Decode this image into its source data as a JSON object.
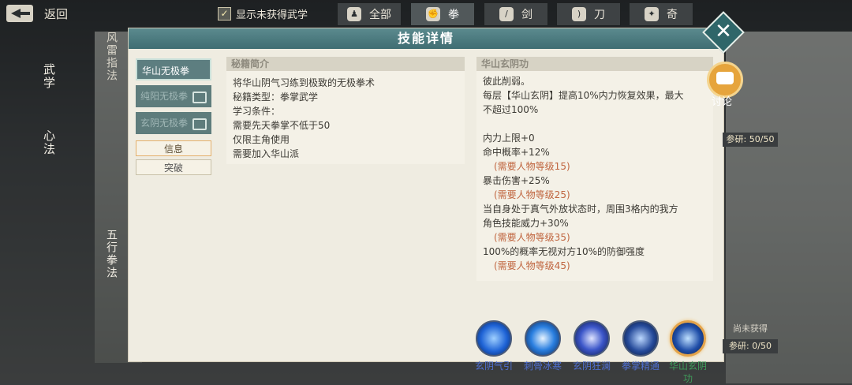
{
  "topbar": {
    "back_label": "返回",
    "show_unobtained_label": "显示未获得武学",
    "filters": [
      {
        "label": "全部",
        "icon": "figure-icon"
      },
      {
        "label": "拳",
        "icon": "fist-icon"
      },
      {
        "label": "剑",
        "icon": "sword-icon"
      },
      {
        "label": "刀",
        "icon": "blade-icon"
      },
      {
        "label": "奇",
        "icon": "shuriken-icon"
      }
    ]
  },
  "left_tabs": {
    "wuxue": "武学",
    "xinfa": "心法",
    "wuxing": "五行拳法",
    "fenglei": "风雷指法"
  },
  "dialog": {
    "title": "技能详情",
    "skills": [
      {
        "label": "华山无极拳",
        "state": "selected"
      },
      {
        "label": "纯阳无极拳",
        "state": "locked"
      },
      {
        "label": "玄阴无极拳",
        "state": "locked"
      }
    ],
    "buttons": {
      "info": "信息",
      "breakthrough": "突破"
    },
    "intro_panel": {
      "header": "秘籍简介",
      "lines": [
        "将华山阴气习练到极致的无极拳术",
        "秘籍类型：拳掌武学",
        "学习条件：",
        "需要先天拳掌不低于50",
        "仅限主角使用",
        "需要加入华山派"
      ]
    },
    "detail_panel": {
      "header": "华山玄阴功",
      "lines": [
        {
          "text": "彼此削弱。",
          "req": false
        },
        {
          "text": "每层【华山玄阴】提高10%内力恢复效果，最大",
          "req": false
        },
        {
          "text": "不超过100%",
          "req": false
        },
        {
          "text": "",
          "req": false
        },
        {
          "text": "内力上限+0",
          "req": false
        },
        {
          "text": "命中概率+12%",
          "req": false
        },
        {
          "text": "(需要人物等级15)",
          "req": true
        },
        {
          "text": "暴击伤害+25%",
          "req": false
        },
        {
          "text": "(需要人物等级25)",
          "req": true
        },
        {
          "text": "当自身处于真气外放状态时，周围3格内的我方",
          "req": false
        },
        {
          "text": "角色技能威力+30%",
          "req": false
        },
        {
          "text": "(需要人物等级35)",
          "req": true
        },
        {
          "text": "100%的概率无视对方10%的防御强度",
          "req": false
        },
        {
          "text": "(需要人物等级45)",
          "req": true
        }
      ]
    },
    "skill_icons": [
      {
        "name": "玄阴气引",
        "color": "#1e63d6"
      },
      {
        "name": "刺骨冰寒",
        "color": "#2a7fe0"
      },
      {
        "name": "玄阴狂澜",
        "color": "#3b56c9"
      },
      {
        "name": "拳掌精通",
        "color": "#254a9a"
      },
      {
        "name": "华山玄阴功",
        "color": "#1f4ea8"
      }
    ]
  },
  "side": {
    "discuss_label": "讨论",
    "research_top": "参研: 50/50",
    "not_obtained": "尚未获得",
    "research_bottom": "参研: 0/50"
  }
}
